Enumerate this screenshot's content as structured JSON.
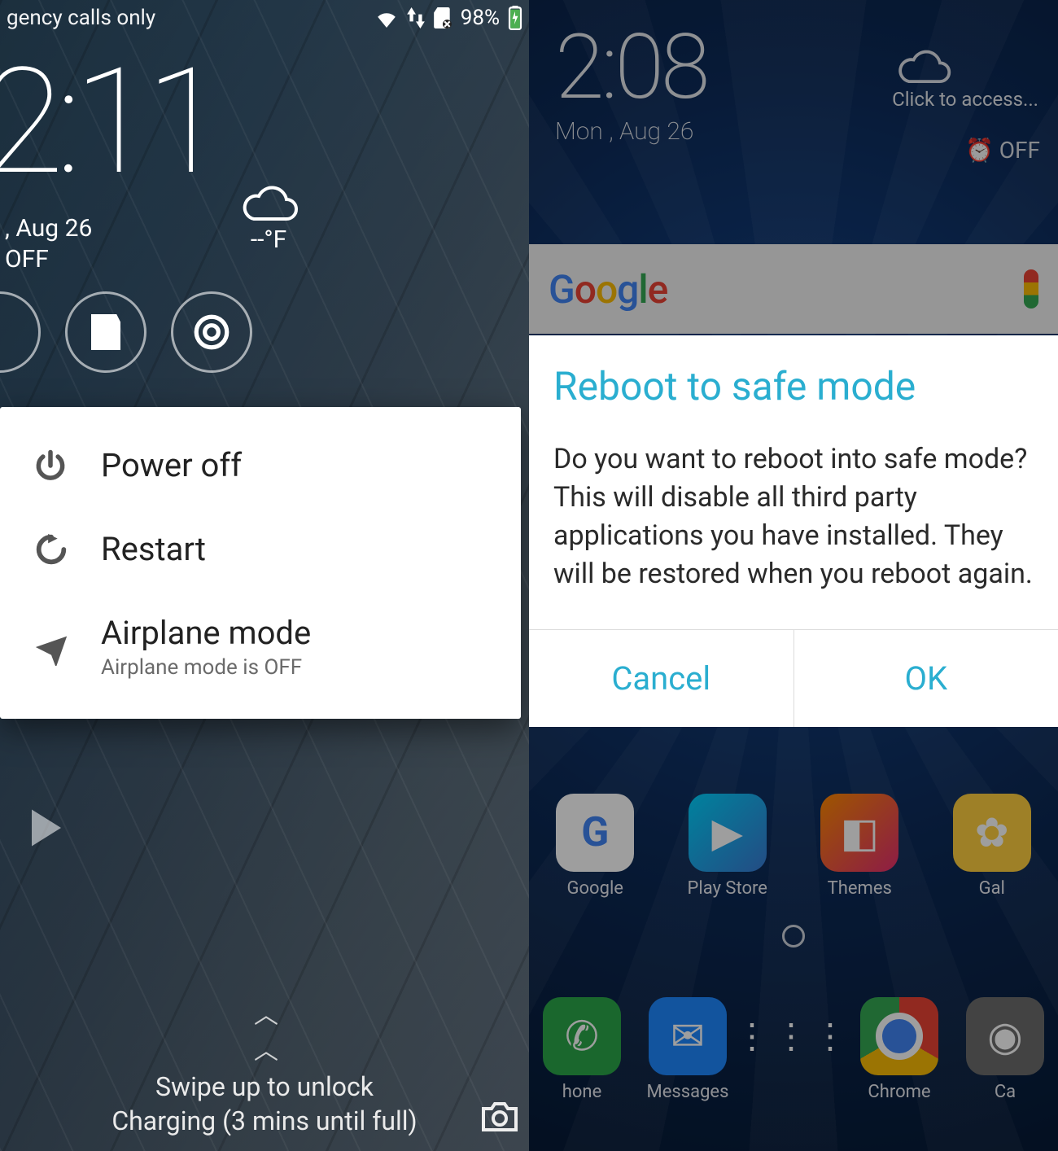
{
  "left": {
    "status": {
      "carrier": "gency calls only",
      "battery": "98%"
    },
    "lockscreen": {
      "time": "2:11",
      "temp": "--°F",
      "date_line1": ", Aug 26",
      "date_line2": "OFF",
      "swipe": "Swipe up to unlock",
      "charging": "Charging (3 mins until full)"
    },
    "power_menu": {
      "power_off": "Power off",
      "restart": "Restart",
      "airplane_title": "Airplane mode",
      "airplane_sub": "Airplane mode is OFF"
    }
  },
  "right": {
    "lockscreen": {
      "time": "2:08",
      "date": "Mon , Aug 26",
      "weather_hint": "Click to access...",
      "alarm": "OFF"
    },
    "search": {
      "logo": "Google"
    },
    "dialog": {
      "title": "Reboot to safe mode",
      "body": "Do you want to reboot into safe mode? This will disable all third party applications you have installed. They will be restored when you reboot again.",
      "cancel": "Cancel",
      "ok": "OK"
    },
    "apps": {
      "google": "Google",
      "play": "Play Store",
      "themes": "Themes",
      "gallery": "Gal",
      "phone": "hone",
      "messages": "Messages",
      "chrome": "Chrome",
      "camera": "Ca"
    }
  }
}
